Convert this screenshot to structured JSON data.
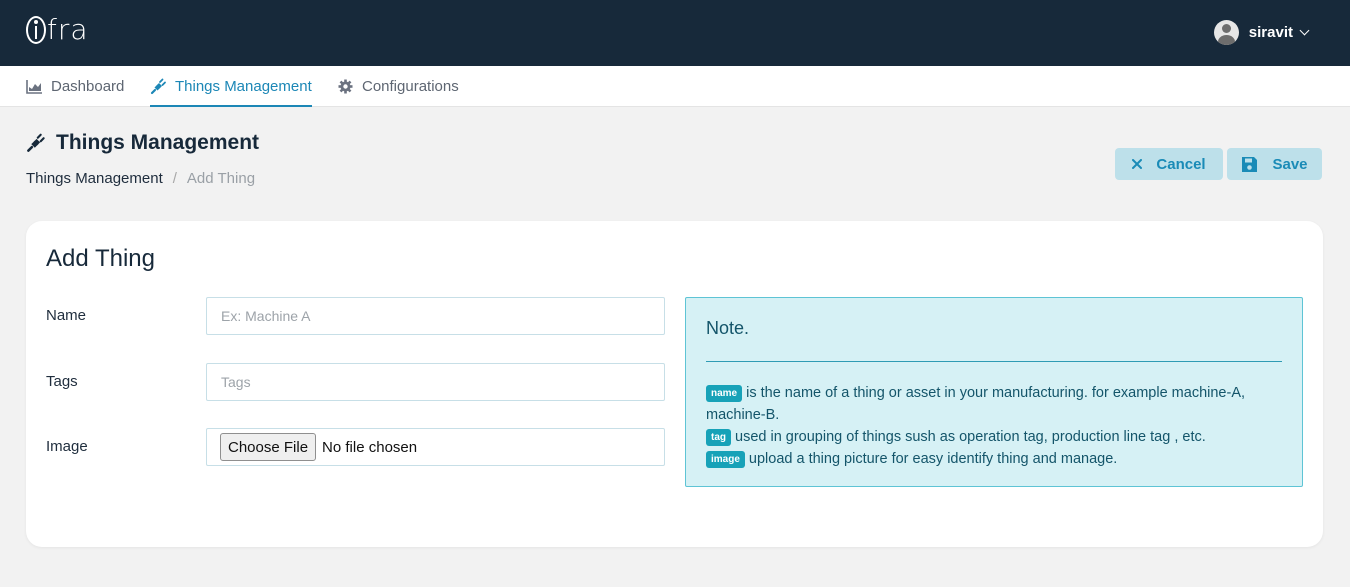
{
  "app": {
    "logo_text": "fra",
    "username": "siravit"
  },
  "nav": {
    "tabs": [
      {
        "label": "Dashboard",
        "icon": "chart-area-icon",
        "active": false
      },
      {
        "label": "Things Management",
        "icon": "plug-icon",
        "active": true
      },
      {
        "label": "Configurations",
        "icon": "gear-icon",
        "active": false
      }
    ]
  },
  "header": {
    "title": "Things Management",
    "breadcrumb": {
      "parent": "Things Management",
      "separator": "/",
      "current": "Add Thing"
    },
    "cancel_label": "Cancel",
    "save_label": "Save"
  },
  "form": {
    "title": "Add Thing",
    "name_label": "Name",
    "name_placeholder": "Ex: Machine A",
    "tags_label": "Tags",
    "tags_placeholder": "Tags",
    "image_label": "Image",
    "file_button": "Choose File",
    "file_status": "No file chosen"
  },
  "note": {
    "title": "Note.",
    "items": [
      {
        "badge": "name",
        "text": "is the name of a thing or asset in your manufacturing. for example machine-A, machine-B."
      },
      {
        "badge": "tag",
        "text": "used in grouping of things sush as operation tag, production line tag , etc."
      },
      {
        "badge": "image",
        "text": "upload a thing picture for easy identify thing and manage."
      }
    ]
  },
  "colors": {
    "topbar": "#17293a",
    "accent": "#1c87b6",
    "button_bg": "#bde0ea",
    "note_bg": "#d6f1f5",
    "badge": "#17a2b8"
  }
}
